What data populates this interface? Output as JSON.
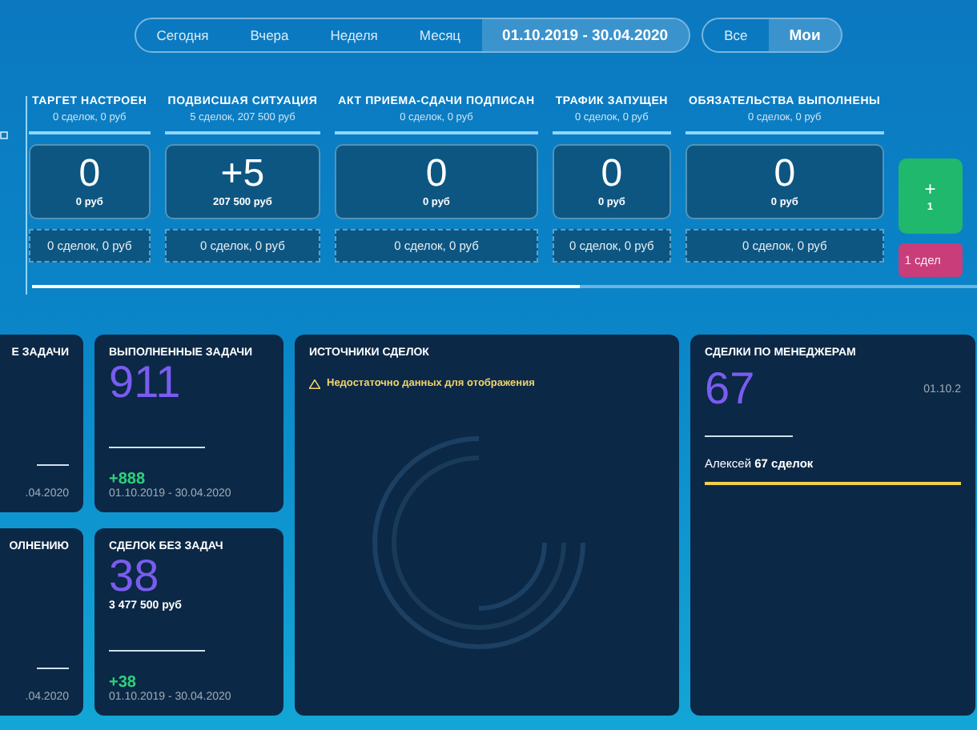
{
  "date_filter": {
    "options": [
      {
        "label": "Сегодня",
        "selected": false
      },
      {
        "label": "Вчера",
        "selected": false
      },
      {
        "label": "Неделя",
        "selected": false
      },
      {
        "label": "Месяц",
        "selected": false
      },
      {
        "label": "01.10.2019 - 30.04.2020",
        "selected": true
      }
    ]
  },
  "owner_filter": {
    "options": [
      {
        "label": "Все",
        "selected": false
      },
      {
        "label": "Мои",
        "selected": true
      }
    ]
  },
  "pipeline": {
    "stages": [
      {
        "kind": "open",
        "title": "ТАРГЕТ НАСТРОЕН",
        "summary": "0 сделок, 0 руб",
        "value": "0",
        "amount": "0 руб",
        "footer": "0 сделок, 0 руб"
      },
      {
        "kind": "open",
        "title": "ПОДВИСШАЯ СИТУАЦИЯ",
        "summary": "5 сделок, 207 500 руб",
        "value": "+5",
        "amount": "207 500 руб",
        "footer": "0 сделок, 0 руб"
      },
      {
        "kind": "open",
        "title": "АКТ ПРИЕМА-СДАЧИ ПОДПИСАН",
        "summary": "0 сделок, 0 руб",
        "value": "0",
        "amount": "0 руб",
        "footer": "0 сделок, 0 руб"
      },
      {
        "kind": "open",
        "title": "ТРАФИК ЗАПУЩЕН",
        "summary": "0 сделок, 0 руб",
        "value": "0",
        "amount": "0 руб",
        "footer": "0 сделок, 0 руб"
      },
      {
        "kind": "open",
        "title": "ОБЯЗАТЕЛЬСТВА ВЫПОЛНЕНЫ",
        "summary": "0 сделок, 0 руб",
        "value": "0",
        "amount": "0 руб",
        "footer": "0 сделок, 0 руб"
      },
      {
        "kind": "result",
        "value": "+",
        "amount": "1",
        "footer": "1 сдел"
      }
    ],
    "progress": {
      "level": 0.58
    }
  },
  "task_tiles": [
    {
      "title": "Е ЗАДАЧИ",
      "period": ".04.2020"
    },
    {
      "title": "ВЫПОЛНЕННЫЕ ЗАДАЧИ",
      "value": "911",
      "delta": "+888",
      "period": "01.10.2019 - 30.04.2020"
    },
    {
      "title": "ОЛНЕНИЮ",
      "period": ".04.2020"
    },
    {
      "title": "СДЕЛОК БЕЗ ЗАДАЧ",
      "value": "38",
      "amount": "3 477 500 руб",
      "delta": "+38",
      "period": "01.10.2019 - 30.04.2020"
    }
  ],
  "sources": {
    "title": "ИСТОЧНИКИ СДЕЛОК",
    "warning": "Недостаточно данных для отображения"
  },
  "managers": {
    "title": "СДЕЛКИ ПО МЕНЕДЖЕРАМ",
    "value": "67",
    "period": "01.10.2",
    "rows": [
      {
        "label": "Алексей **67 сделок**",
        "level": 1
      }
    ]
  }
}
